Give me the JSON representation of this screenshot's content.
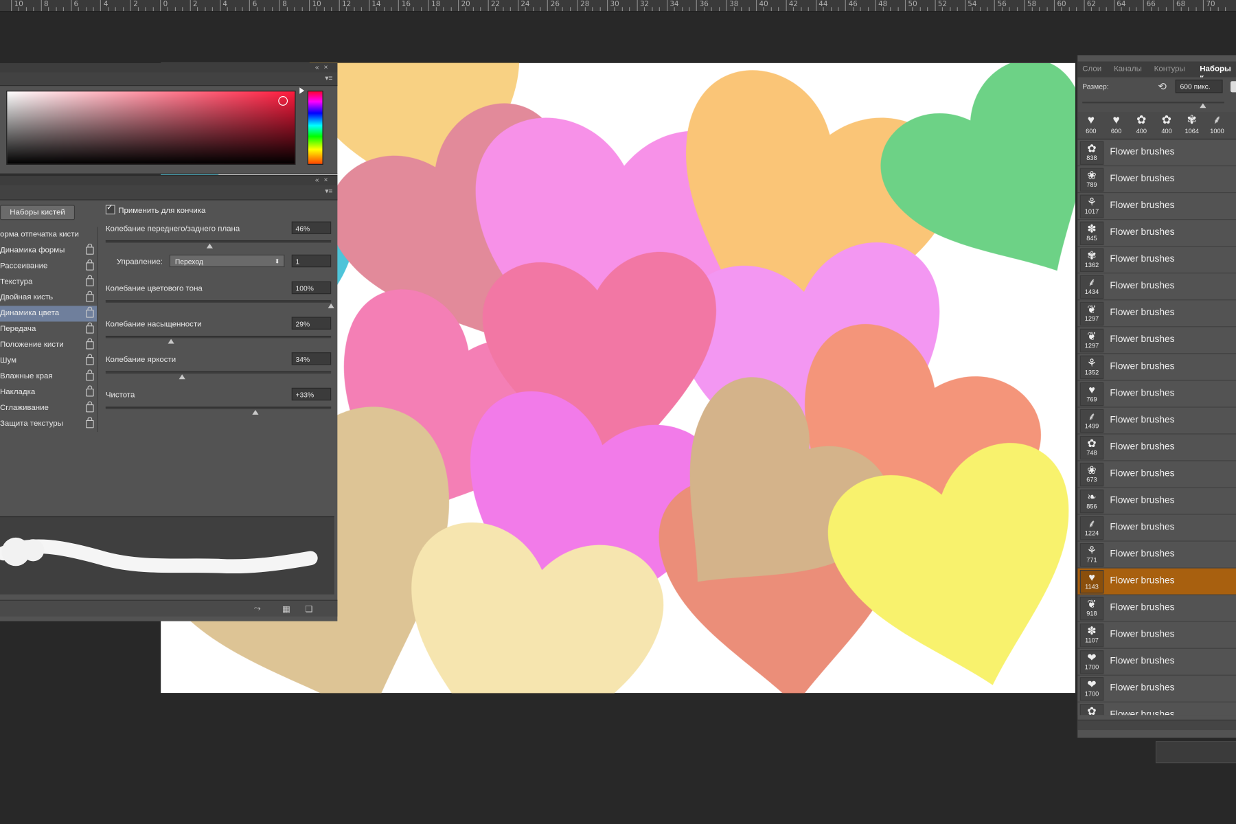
{
  "ruler": {
    "labels": [
      "10",
      "8",
      "6",
      "4",
      "2",
      "0",
      "2",
      "4",
      "6",
      "8",
      "10",
      "12",
      "14",
      "16",
      "18",
      "20",
      "22",
      "24",
      "26",
      "28",
      "30",
      "32",
      "34",
      "36",
      "38",
      "40",
      "42",
      "44",
      "46",
      "48",
      "50",
      "52",
      "54",
      "56",
      "58",
      "60",
      "62",
      "64",
      "66",
      "68",
      "70"
    ]
  },
  "color_panel": {
    "accent": "#ff1a3d"
  },
  "brush_panel": {
    "presets_button": "Наборы кистей",
    "apply_per_tip": "Применить для кончика",
    "categories": [
      {
        "label": "орма отпечатка кисти",
        "active": false,
        "lock": false
      },
      {
        "label": "Динамика формы",
        "active": false,
        "lock": true
      },
      {
        "label": "Рассеивание",
        "active": false,
        "lock": true
      },
      {
        "label": "Текстура",
        "active": false,
        "lock": true
      },
      {
        "label": "Двойная кисть",
        "active": false,
        "lock": true
      },
      {
        "label": "Динамика цвета",
        "active": true,
        "lock": true
      },
      {
        "label": "Передача",
        "active": false,
        "lock": true
      },
      {
        "label": "Положение кисти",
        "active": false,
        "lock": true
      },
      {
        "label": "Шум",
        "active": false,
        "lock": true
      },
      {
        "label": "Влажные края",
        "active": false,
        "lock": true
      },
      {
        "label": "Накладка",
        "active": false,
        "lock": true
      },
      {
        "label": "Сглаживание",
        "active": false,
        "lock": true
      },
      {
        "label": "Защита текстуры",
        "active": false,
        "lock": true
      }
    ],
    "fg_bg_jitter": {
      "label": "Колебание переднего/заднего плана",
      "value": "46%",
      "fraction": 0.46
    },
    "control": {
      "label": "Управление:",
      "value": "Переход",
      "steps": "1"
    },
    "hue_jitter": {
      "label": "Колебание цветового тона",
      "value": "100%",
      "fraction": 1.0
    },
    "saturation_jitter": {
      "label": "Колебание насыщенности",
      "value": "29%",
      "fraction": 0.29
    },
    "brightness_jitter": {
      "label": "Колебание яркости",
      "value": "34%",
      "fraction": 0.34
    },
    "purity": {
      "label": "Чистота",
      "value": "+33%",
      "fraction": 0.665
    }
  },
  "right_panel": {
    "tabs": [
      {
        "label": "Слои",
        "active": false
      },
      {
        "label": "Каналы",
        "active": false
      },
      {
        "label": "Контуры",
        "active": false
      },
      {
        "label": "Наборы к",
        "active": true
      }
    ],
    "size_label": "Размер:",
    "size_value": "600 пикс.",
    "size_fraction": 0.85,
    "recent_brushes": [
      {
        "icon": "heart-icon",
        "glyph": "♥",
        "size": "600"
      },
      {
        "icon": "heart-icon",
        "glyph": "♥",
        "size": "600"
      },
      {
        "icon": "flower-icon",
        "glyph": "✿",
        "size": "400"
      },
      {
        "icon": "flower-icon",
        "glyph": "✿",
        "size": "400"
      },
      {
        "icon": "flower-icon",
        "glyph": "✾",
        "size": "1064"
      },
      {
        "icon": "stem-icon",
        "glyph": "⸙",
        "size": "1000"
      }
    ],
    "brushes": [
      {
        "size": "838",
        "name": "Flower brushes",
        "glyph": "✿",
        "selected": false
      },
      {
        "size": "789",
        "name": "Flower brushes",
        "glyph": "❀",
        "selected": false
      },
      {
        "size": "1017",
        "name": "Flower brushes",
        "glyph": "⚘",
        "selected": false
      },
      {
        "size": "845",
        "name": "Flower brushes",
        "glyph": "✽",
        "selected": false
      },
      {
        "size": "1362",
        "name": "Flower brushes",
        "glyph": "✾",
        "selected": false
      },
      {
        "size": "1434",
        "name": "Flower brushes",
        "glyph": "⸙",
        "selected": false
      },
      {
        "size": "1297",
        "name": "Flower brushes",
        "glyph": "❦",
        "selected": false
      },
      {
        "size": "1297",
        "name": "Flower brushes",
        "glyph": "❦",
        "selected": false
      },
      {
        "size": "1352",
        "name": "Flower brushes",
        "glyph": "⚘",
        "selected": false
      },
      {
        "size": "769",
        "name": "Flower brushes",
        "glyph": "♥",
        "selected": false
      },
      {
        "size": "1499",
        "name": "Flower brushes",
        "glyph": "⸙",
        "selected": false
      },
      {
        "size": "748",
        "name": "Flower brushes",
        "glyph": "✿",
        "selected": false
      },
      {
        "size": "673",
        "name": "Flower brushes",
        "glyph": "❀",
        "selected": false
      },
      {
        "size": "856",
        "name": "Flower brushes",
        "glyph": "❧",
        "selected": false
      },
      {
        "size": "1224",
        "name": "Flower brushes",
        "glyph": "⸙",
        "selected": false
      },
      {
        "size": "771",
        "name": "Flower brushes",
        "glyph": "⚘",
        "selected": false
      },
      {
        "size": "1143",
        "name": "Flower brushes",
        "glyph": "♥",
        "selected": true
      },
      {
        "size": "918",
        "name": "Flower brushes",
        "glyph": "❦",
        "selected": false
      },
      {
        "size": "1107",
        "name": "Flower brushes",
        "glyph": "✽",
        "selected": false
      },
      {
        "size": "1700",
        "name": "Flower brushes",
        "glyph": "❤",
        "selected": false
      },
      {
        "size": "1700",
        "name": "Flower brushes",
        "glyph": "❤",
        "selected": false
      },
      {
        "size": "",
        "name": "Flower brushes",
        "glyph": "✿",
        "selected": false
      }
    ]
  },
  "colors": {
    "selected_row": "#a8600f",
    "active_category": "#6f7f9c",
    "panel": "#535353",
    "workspace": "#282828"
  }
}
